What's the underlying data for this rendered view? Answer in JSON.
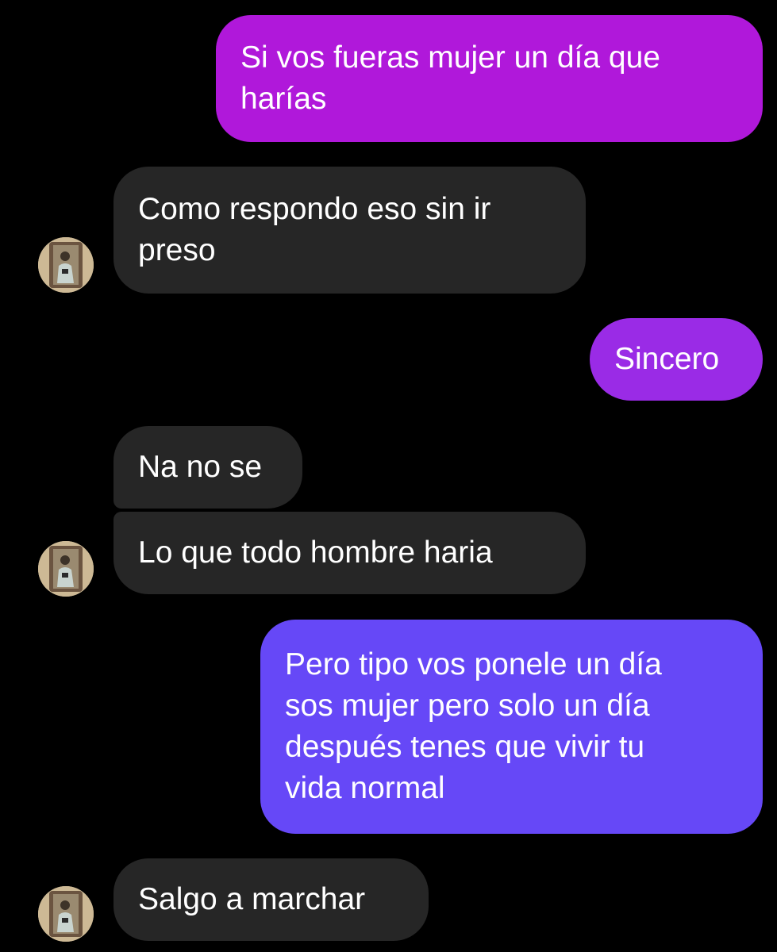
{
  "colors": {
    "background": "#000000",
    "received_bubble": "#262626",
    "sent_gradient_top": "#b516d8",
    "sent_gradient_bottom": "#6345f8",
    "text": "#ffffff"
  },
  "messages": [
    {
      "direction": "sent",
      "text": "Si vos fueras mujer un día que\nharías"
    },
    {
      "direction": "received",
      "text": "Como respondo eso sin ir\npreso"
    },
    {
      "direction": "sent",
      "text": "Sincero"
    },
    {
      "direction": "received",
      "text": "Na no se"
    },
    {
      "direction": "received",
      "text": "Lo que todo hombre haria"
    },
    {
      "direction": "sent",
      "text": "Pero tipo vos ponele un día\nsos mujer pero solo un día\ndespués tenes que vivir tu\nvida normal"
    },
    {
      "direction": "received",
      "text": "Salgo a marchar"
    }
  ],
  "avatar_icon": "contact-photo"
}
